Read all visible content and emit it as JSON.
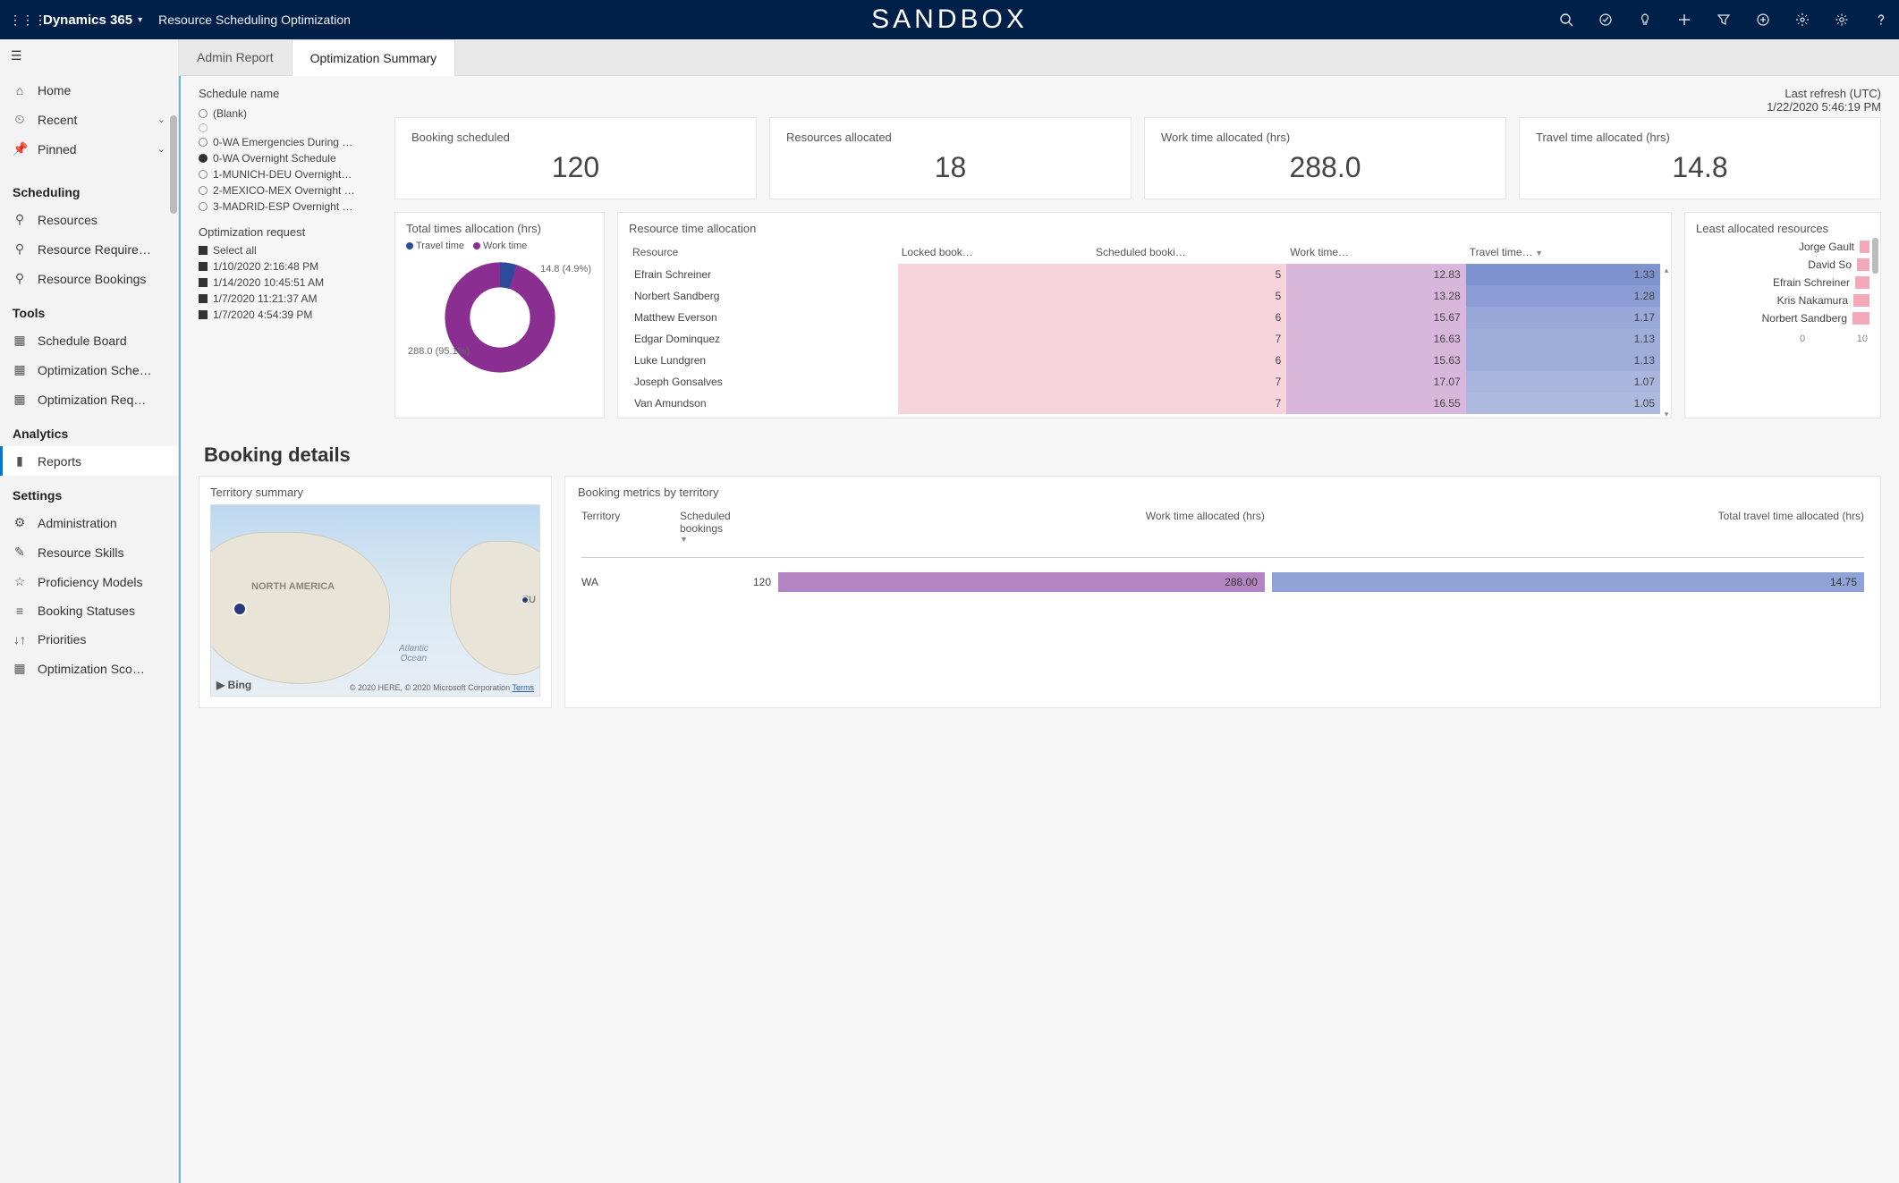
{
  "header": {
    "brand": "Dynamics 365",
    "app_title": "Resource Scheduling Optimization",
    "env": "SANDBOX"
  },
  "sidebar": {
    "top": [
      {
        "icon": "⌂",
        "label": "Home",
        "name": "sidebar-item-home"
      },
      {
        "icon": "⏲",
        "label": "Recent",
        "caret": true,
        "name": "sidebar-item-recent"
      },
      {
        "icon": "📌",
        "label": "Pinned",
        "caret": true,
        "name": "sidebar-item-pinned"
      }
    ],
    "sections": [
      {
        "title": "Scheduling",
        "items": [
          {
            "icon": "⚲",
            "label": "Resources",
            "name": "sidebar-item-resources"
          },
          {
            "icon": "⚲",
            "label": "Resource Require…",
            "name": "sidebar-item-resource-requirements"
          },
          {
            "icon": "⚲",
            "label": "Resource Bookings",
            "name": "sidebar-item-resource-bookings"
          }
        ]
      },
      {
        "title": "Tools",
        "items": [
          {
            "icon": "▦",
            "label": "Schedule Board",
            "name": "sidebar-item-schedule-board"
          },
          {
            "icon": "▦",
            "label": "Optimization Sche…",
            "name": "sidebar-item-optimization-schedules"
          },
          {
            "icon": "▦",
            "label": "Optimization Req…",
            "name": "sidebar-item-optimization-requests"
          }
        ]
      },
      {
        "title": "Analytics",
        "items": [
          {
            "icon": "▮",
            "label": "Reports",
            "name": "sidebar-item-reports",
            "active": true
          }
        ]
      },
      {
        "title": "Settings",
        "items": [
          {
            "icon": "⚙",
            "label": "Administration",
            "name": "sidebar-item-administration"
          },
          {
            "icon": "✎",
            "label": "Resource Skills",
            "name": "sidebar-item-resource-skills"
          },
          {
            "icon": "☆",
            "label": "Proficiency Models",
            "name": "sidebar-item-proficiency-models"
          },
          {
            "icon": "≡",
            "label": "Booking Statuses",
            "name": "sidebar-item-booking-statuses"
          },
          {
            "icon": "↓↑",
            "label": "Priorities",
            "name": "sidebar-item-priorities"
          },
          {
            "icon": "▦",
            "label": "Optimization Sco…",
            "name": "sidebar-item-optimization-scopes"
          }
        ]
      }
    ]
  },
  "tabs": {
    "items": [
      "Admin Report",
      "Optimization Summary"
    ],
    "active": 1
  },
  "filters": {
    "schedule_title": "Schedule name",
    "schedules": [
      {
        "label": "(Blank)",
        "sel": false
      },
      {
        "label": "",
        "sel": false,
        "empty": true
      },
      {
        "label": "0-WA Emergencies During …",
        "sel": false
      },
      {
        "label": "0-WA Overnight Schedule",
        "sel": true
      },
      {
        "label": "1-MUNICH-DEU Overnight…",
        "sel": false
      },
      {
        "label": "2-MEXICO-MEX Overnight …",
        "sel": false
      },
      {
        "label": "3-MADRID-ESP Overnight …",
        "sel": false
      }
    ],
    "opt_title": "Optimization request",
    "opt_requests": [
      "Select all",
      "1/10/2020 2:16:48 PM",
      "1/14/2020 10:45:51 AM",
      "1/7/2020 11:21:37 AM",
      "1/7/2020 4:54:39 PM"
    ]
  },
  "refresh": {
    "label": "Last refresh (UTC)",
    "value": "1/22/2020 5:46:19 PM"
  },
  "kpis": [
    {
      "label": "Booking scheduled",
      "value": "120"
    },
    {
      "label": "Resources allocated",
      "value": "18"
    },
    {
      "label": "Work time allocated (hrs)",
      "value": "288.0"
    },
    {
      "label": "Travel time allocated (hrs)",
      "value": "14.8"
    }
  ],
  "donut": {
    "title": "Total times allocation (hrs)",
    "legend_travel": "Travel time",
    "legend_work": "Work time",
    "anno_travel": "14.8 (4.9%)",
    "anno_work": "288.0 (95.1%)",
    "colors": {
      "travel": "#2c4b9a",
      "work": "#8a2f91"
    }
  },
  "res_table": {
    "title": "Resource time allocation",
    "cols": [
      "Resource",
      "Locked book…",
      "Scheduled booki…",
      "Work time…",
      "Travel time…"
    ],
    "rows": [
      {
        "r": "Efrain Schreiner",
        "lb": "",
        "sb": "5",
        "wt": "12.83",
        "tt": "1.33",
        "tt_shade": "#7f94cf"
      },
      {
        "r": "Norbert Sandberg",
        "lb": "",
        "sb": "5",
        "wt": "13.28",
        "tt": "1.28",
        "tt_shade": "#8a9cd3"
      },
      {
        "r": "Matthew Everson",
        "lb": "",
        "sb": "6",
        "wt": "15.67",
        "tt": "1.17",
        "tt_shade": "#98a8d8"
      },
      {
        "r": "Edgar Dominquez",
        "lb": "",
        "sb": "7",
        "wt": "16.63",
        "tt": "1.13",
        "tt_shade": "#9fadda"
      },
      {
        "r": "Luke Lundgren",
        "lb": "",
        "sb": "6",
        "wt": "15.63",
        "tt": "1.13",
        "tt_shade": "#9fadda"
      },
      {
        "r": "Joseph Gonsalves",
        "lb": "",
        "sb": "7",
        "wt": "17.07",
        "tt": "1.07",
        "tt_shade": "#aab6de"
      },
      {
        "r": "Van Amundson",
        "lb": "",
        "sb": "7",
        "wt": "16.55",
        "tt": "1.05",
        "tt_shade": "#aeb9df"
      }
    ]
  },
  "least": {
    "title": "Least allocated resources",
    "max": 10,
    "items": [
      {
        "name": "Jorge Gault",
        "v": 1.5
      },
      {
        "name": "David So",
        "v": 2.0
      },
      {
        "name": "Efrain Schreiner",
        "v": 2.3
      },
      {
        "name": "Kris Nakamura",
        "v": 2.5
      },
      {
        "name": "Norbert Sandberg",
        "v": 2.7
      }
    ],
    "axis_min": "0",
    "axis_max": "10"
  },
  "booking_details": {
    "title": "Booking details",
    "map_title": "Territory summary",
    "map": {
      "na": "NORTH AMERICA",
      "eu": "EU",
      "ocean": "Atlantic\nOcean",
      "bing": "▶ Bing",
      "copy": "© 2020 HERE, © 2020 Microsoft Corporation ",
      "terms": "Terms"
    },
    "metrics_title": "Booking metrics by territory",
    "metrics_cols": [
      "Territory",
      "Scheduled bookings",
      "Work time allocated (hrs)",
      "Total travel time allocated (hrs)"
    ],
    "metrics_row": {
      "territory": "WA",
      "scheduled": "120",
      "work": "288.00",
      "travel": "14.75",
      "work_color": "#b585c3",
      "travel_color": "#8fa3d6"
    }
  },
  "chart_data": [
    {
      "type": "pie",
      "title": "Total times allocation (hrs)",
      "categories": [
        "Travel time",
        "Work time"
      ],
      "values": [
        14.8,
        288.0
      ],
      "percentages": [
        4.9,
        95.1
      ]
    },
    {
      "type": "table",
      "title": "Resource time allocation",
      "columns": [
        "Resource",
        "Locked bookings",
        "Scheduled bookings",
        "Work time (hrs)",
        "Travel time (hrs)"
      ],
      "rows": [
        [
          "Efrain Schreiner",
          null,
          5,
          12.83,
          1.33
        ],
        [
          "Norbert Sandberg",
          null,
          5,
          13.28,
          1.28
        ],
        [
          "Matthew Everson",
          null,
          6,
          15.67,
          1.17
        ],
        [
          "Edgar Dominquez",
          null,
          7,
          16.63,
          1.13
        ],
        [
          "Luke Lundgren",
          null,
          6,
          15.63,
          1.13
        ],
        [
          "Joseph Gonsalves",
          null,
          7,
          17.07,
          1.07
        ],
        [
          "Van Amundson",
          null,
          7,
          16.55,
          1.05
        ]
      ]
    },
    {
      "type": "bar",
      "title": "Least allocated resources",
      "orientation": "horizontal",
      "categories": [
        "Jorge Gault",
        "David So",
        "Efrain Schreiner",
        "Kris Nakamura",
        "Norbert Sandberg"
      ],
      "values": [
        1.5,
        2.0,
        2.3,
        2.5,
        2.7
      ],
      "xlim": [
        0,
        10
      ]
    },
    {
      "type": "table",
      "title": "Booking metrics by territory",
      "columns": [
        "Territory",
        "Scheduled bookings",
        "Work time allocated (hrs)",
        "Total travel time allocated (hrs)"
      ],
      "rows": [
        [
          "WA",
          120,
          288.0,
          14.75
        ]
      ]
    }
  ]
}
